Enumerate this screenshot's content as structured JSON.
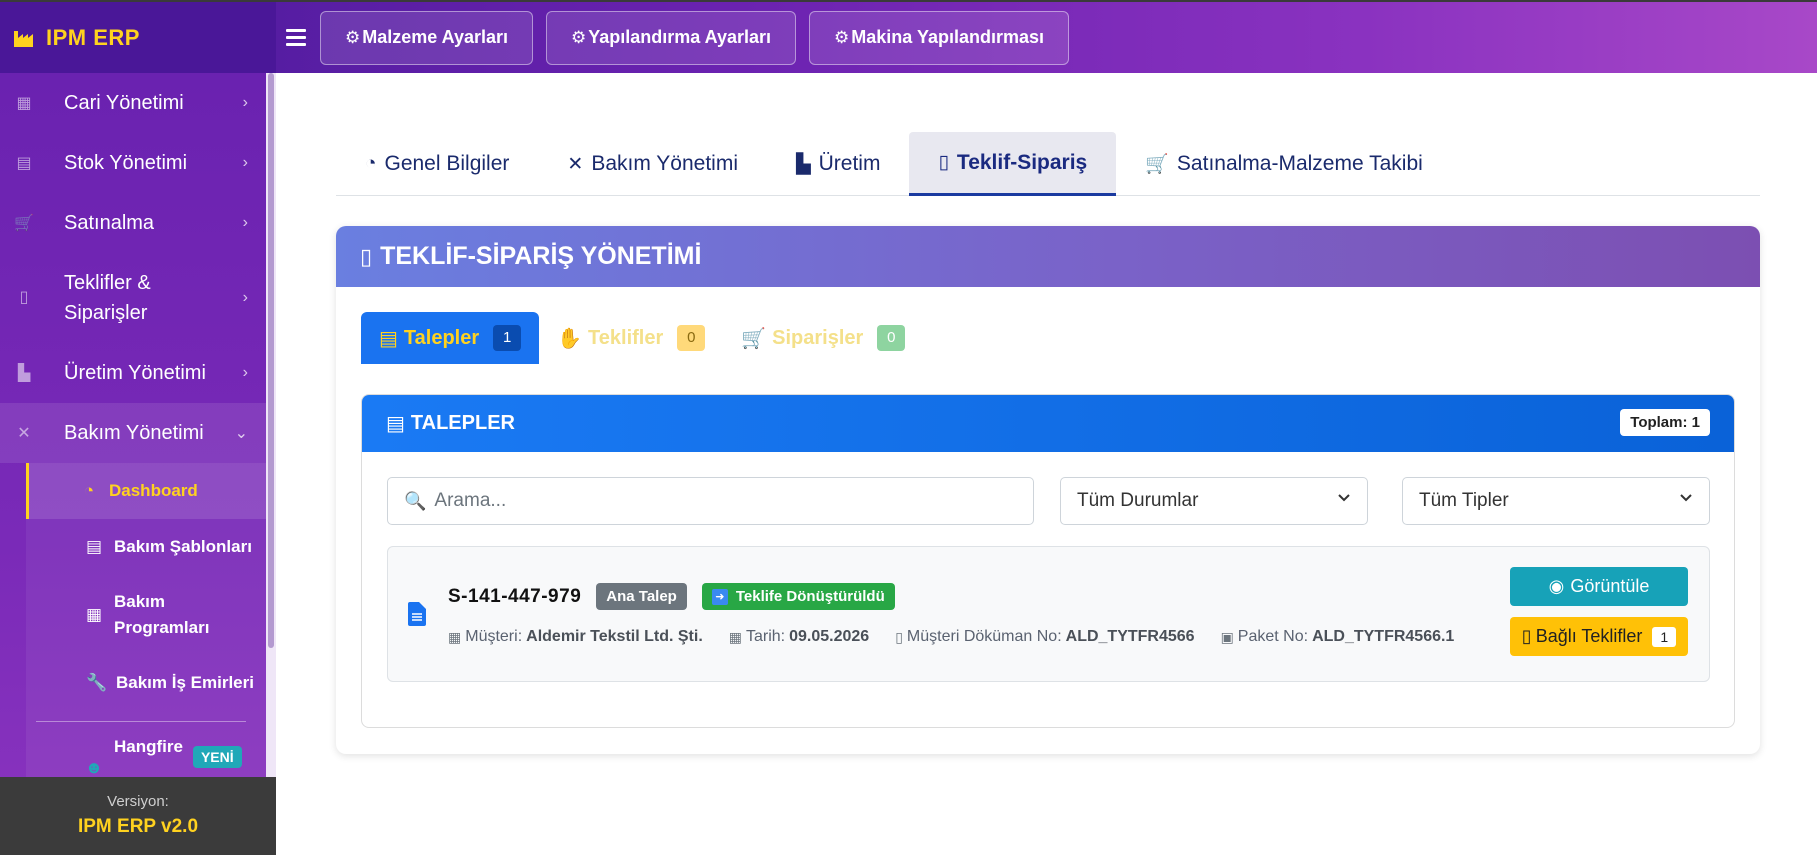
{
  "brand": {
    "name": "IPM ERP"
  },
  "topbar": {
    "buttons": [
      {
        "label": "Malzeme Ayarları",
        "icon": "cubes-icon"
      },
      {
        "label": "Yapılandırma Ayarları",
        "icon": "gear-icon"
      },
      {
        "label": "Makina Yapılandırması",
        "icon": "gears-icon"
      }
    ]
  },
  "sidebar": {
    "items": [
      {
        "label": "Cari Yönetimi",
        "icon": "building-icon"
      },
      {
        "label": "Stok Yönetimi",
        "icon": "boxes-icon"
      },
      {
        "label": "Satınalma",
        "icon": "cart-icon"
      },
      {
        "label": "Teklifler &",
        "label2": "Siparişler",
        "icon": "invoice-icon"
      },
      {
        "label": "Üretim Yönetimi",
        "icon": "industry-icon"
      },
      {
        "label": "Bakım Yönetimi",
        "icon": "tools-icon"
      }
    ],
    "submenu": [
      {
        "label": "Dashboard",
        "icon": "gauge-icon"
      },
      {
        "label": "Bakım Şablonları",
        "icon": "clipboard-icon"
      },
      {
        "label": "Bakım",
        "label2": "Programları",
        "icon": "calendar-icon"
      },
      {
        "label": "Bakım İş Emirleri",
        "icon": "wrench-icon"
      },
      {
        "label": "Hangfire",
        "icon": "robot-icon",
        "badge": "YENİ"
      }
    ],
    "footer": {
      "version_label": "Versiyon:",
      "version": "IPM ERP v2.0"
    }
  },
  "main_tabs": [
    {
      "label": "Genel Bilgiler",
      "icon": "gauge-icon"
    },
    {
      "label": "Bakım Yönetimi",
      "icon": "tools-icon"
    },
    {
      "label": "Üretim",
      "icon": "industry-icon"
    },
    {
      "label": "Teklif-Sipariş",
      "icon": "invoice-icon",
      "active": true
    },
    {
      "label": "Satınalma-Malzeme Takibi",
      "icon": "cart-icon"
    }
  ],
  "card": {
    "title": "TEKLİF-SİPARİŞ YÖNETİMİ"
  },
  "sub_tabs": [
    {
      "label": "Talepler",
      "count": "1",
      "icon": "file-icon",
      "active": true
    },
    {
      "label": "Teklifler",
      "count": "0",
      "icon": "hand-money-icon"
    },
    {
      "label": "Siparişler",
      "count": "0",
      "icon": "cart-icon"
    }
  ],
  "panel": {
    "title": "TALEPLER",
    "total": "Toplam: 1",
    "search_placeholder": "Arama...",
    "status_filter": "Tüm Durumlar",
    "type_filter": "Tüm Tipler"
  },
  "record": {
    "id": "S-141-447-979",
    "type_badge": "Ana Talep",
    "status_badge": "Teklife Dönüştürüldü",
    "customer_label": "Müşteri:",
    "customer": "Aldemir Tekstil Ltd. Şti.",
    "date_label": "Tarih:",
    "date": "09.05.2026",
    "doc_label": "Müşteri Döküman No:",
    "doc": "ALD_TYTFR4566",
    "package_label": "Paket No:",
    "package": "ALD_TYTFR4566.1",
    "view_button": "Görüntüle",
    "linked_button": "Bağlı Teklifler",
    "linked_count": "1"
  },
  "colors": {
    "accent_yellow": "#ffd21f",
    "primary_blue": "#1a73f0",
    "info": "#17a2b8",
    "success": "#28a745",
    "warning": "#ffc107"
  }
}
